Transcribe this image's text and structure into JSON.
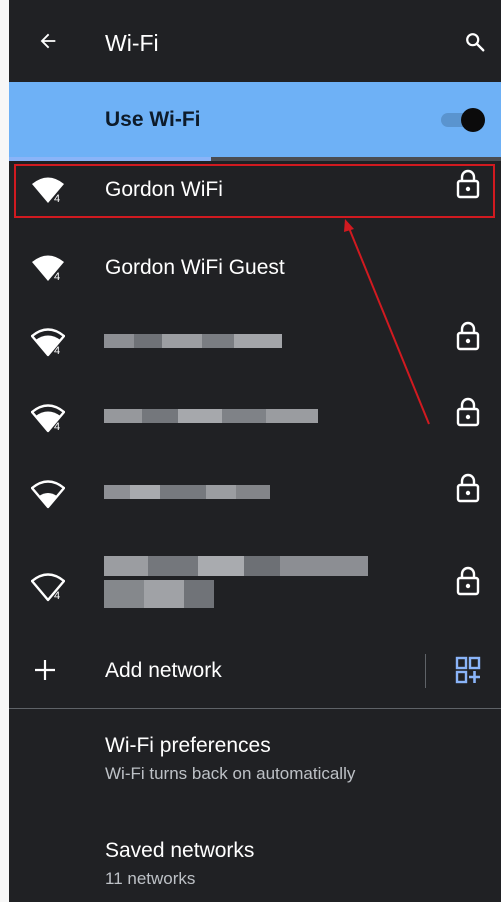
{
  "header": {
    "title": "Wi-Fi"
  },
  "master_switch": {
    "label": "Use Wi-Fi",
    "on": true,
    "accent": "#6eb1f6"
  },
  "networks": [
    {
      "name": "Gordon WiFi",
      "secured": true,
      "signal_icon": "wifi-4-icon"
    },
    {
      "name": "Gordon WiFi Guest",
      "secured": false,
      "signal_icon": "wifi-4-icon"
    },
    {
      "name": "",
      "secured": true,
      "signal_icon": "wifi-4-icon"
    },
    {
      "name": "",
      "secured": true,
      "signal_icon": "wifi-4-icon"
    },
    {
      "name": "",
      "secured": true,
      "signal_icon": "wifi-icon"
    },
    {
      "name": "",
      "secured": true,
      "signal_icon": "wifi-weak-4-icon"
    }
  ],
  "add_network": {
    "label": "Add network"
  },
  "preferences": {
    "title": "Wi-Fi preferences",
    "subtitle": "Wi-Fi turns back on automatically"
  },
  "saved": {
    "title": "Saved networks",
    "subtitle": "11 networks"
  },
  "annotation": {
    "color": "#d11a20"
  }
}
